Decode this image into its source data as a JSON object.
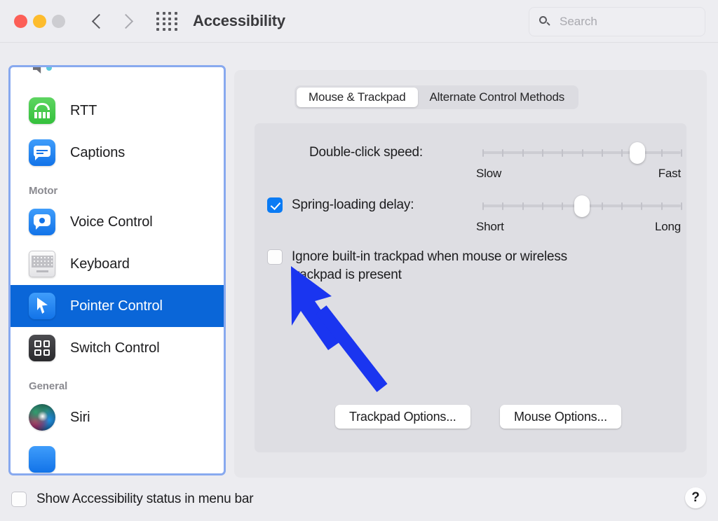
{
  "window": {
    "title": "Accessibility",
    "traffic_lights": [
      "close",
      "minimize",
      "zoom"
    ],
    "back_label": "Back",
    "forward_label": "Forward",
    "grid_label": "Show All"
  },
  "search": {
    "placeholder": "Search",
    "value": "",
    "icon": "search-icon"
  },
  "sidebar": {
    "items": [
      {
        "label": "",
        "icon": "audio-icon",
        "type": "item",
        "selected": false,
        "clipped": true
      },
      {
        "label": "RTT",
        "icon": "rtt-icon",
        "type": "item",
        "selected": false
      },
      {
        "label": "Captions",
        "icon": "captions-icon",
        "type": "item",
        "selected": false
      },
      {
        "label": "Motor",
        "type": "header"
      },
      {
        "label": "Voice Control",
        "icon": "voice-control-icon",
        "type": "item",
        "selected": false
      },
      {
        "label": "Keyboard",
        "icon": "keyboard-icon",
        "type": "item",
        "selected": false
      },
      {
        "label": "Pointer Control",
        "icon": "pointer-control-icon",
        "type": "item",
        "selected": true
      },
      {
        "label": "Switch Control",
        "icon": "switch-control-icon",
        "type": "item",
        "selected": false
      },
      {
        "label": "General",
        "type": "header"
      },
      {
        "label": "Siri",
        "icon": "siri-icon",
        "type": "item",
        "selected": false
      },
      {
        "label": "",
        "icon": "descriptions-icon",
        "type": "item",
        "selected": false,
        "clipped": true
      }
    ]
  },
  "main": {
    "tabs": [
      {
        "label": "Mouse & Trackpad",
        "active": true
      },
      {
        "label": "Alternate Control Methods",
        "active": false
      }
    ],
    "double_click": {
      "label": "Double-click speed:",
      "min_label": "Slow",
      "max_label": "Fast",
      "value_percent": 78,
      "tick_count": 11
    },
    "spring_loading": {
      "label": "Spring-loading delay:",
      "checked": true,
      "min_label": "Short",
      "max_label": "Long",
      "value_percent": 50,
      "tick_count": 11
    },
    "ignore_trackpad": {
      "label": "Ignore built-in trackpad when mouse or wireless trackpad is present",
      "checked": false
    },
    "buttons": [
      {
        "label": "Trackpad Options..."
      },
      {
        "label": "Mouse Options..."
      }
    ]
  },
  "footer": {
    "show_status": {
      "label": "Show Accessibility status in menu bar",
      "checked": false
    },
    "help_label": "?"
  },
  "colors": {
    "accent": "#0a66d8",
    "checkbox_checked": "#0a7bf4",
    "sidebar_focus_ring": "#88a9ef",
    "annotation_arrow": "#1a35f0"
  }
}
